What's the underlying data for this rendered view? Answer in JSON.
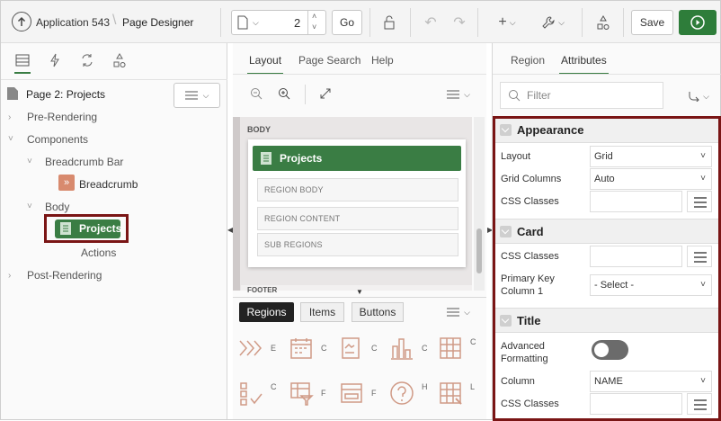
{
  "header": {
    "app_name": "Application 543",
    "page_designer": "Page Designer",
    "page_number": "2",
    "go_label": "Go",
    "save_label": "Save"
  },
  "left": {
    "page_title": "Page 2: Projects",
    "tree": {
      "pre_rendering": "Pre-Rendering",
      "components": "Components",
      "breadcrumb_bar": "Breadcrumb Bar",
      "breadcrumb": "Breadcrumb",
      "body": "Body",
      "projects": "Projects",
      "actions": "Actions",
      "post_rendering": "Post-Rendering"
    }
  },
  "middle": {
    "tabs": [
      "Layout",
      "Page Search",
      "Help"
    ],
    "body_label": "BODY",
    "region_title": "Projects",
    "region_body": "REGION BODY",
    "region_content": "REGION CONTENT",
    "sub_regions": "SUB REGIONS",
    "footer_label": "FOOTER",
    "gallery_tabs": [
      "Regions",
      "Items",
      "Buttons"
    ],
    "gallery_letters": [
      "E",
      "C",
      "C",
      "C",
      "C",
      "C",
      "F",
      "F",
      "H",
      "L"
    ]
  },
  "right": {
    "tabs": [
      "Region",
      "Attributes"
    ],
    "filter_placeholder": "Filter",
    "appearance": {
      "title": "Appearance",
      "layout_label": "Layout",
      "layout_value": "Grid",
      "grid_columns_label": "Grid Columns",
      "grid_columns_value": "Auto",
      "css_classes_label": "CSS Classes"
    },
    "card": {
      "title": "Card",
      "css_classes_label": "CSS Classes",
      "primary_key_label_1": "Primary Key",
      "primary_key_label_2": "Column 1",
      "primary_key_value": "- Select -"
    },
    "title_section": {
      "title": "Title",
      "advanced_label_1": "Advanced",
      "advanced_label_2": "Formatting",
      "advanced_on": false,
      "column_label": "Column",
      "column_value": "NAME",
      "css_classes_label": "CSS Classes"
    }
  },
  "colors": {
    "accent_green": "#3a7d44",
    "highlight_border": "#7a1515",
    "run_button": "#2e7d3a"
  }
}
